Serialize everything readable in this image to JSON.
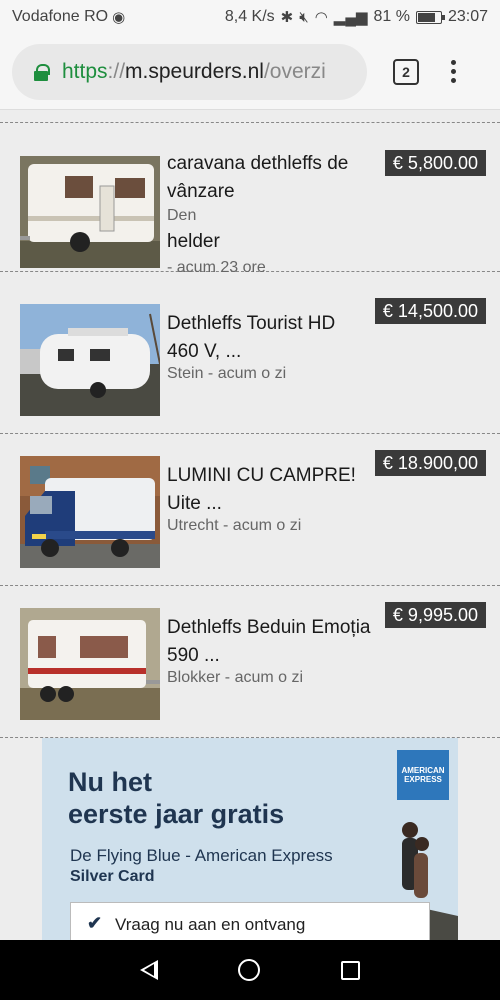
{
  "status_bar": {
    "carrier": "Vodafone RO",
    "speed": "8,4 K/s",
    "battery": "81 %",
    "battery_level": 0.81,
    "time": "23:07",
    "icons": [
      "whatsapp-icon",
      "bluetooth-icon",
      "mute-icon",
      "wifi-icon",
      "signal-icon",
      "battery-icon"
    ]
  },
  "browser": {
    "url_scheme": "https",
    "url_sep": "://",
    "url_host": "m.speurders.nl",
    "url_path": "/overzi",
    "tab_count": "2",
    "accent": "#1e8e3e"
  },
  "listings": [
    {
      "title": "caravana dethleffs de vânzare",
      "location_line1": "Den",
      "location_line2": "helder",
      "time": "- acum 23 ore",
      "price": "€ 5,800.00"
    },
    {
      "title": "Dethleffs Tourist HD 460 V, ...",
      "meta": "Stein - acum o zi",
      "price": "€ 14,500.00"
    },
    {
      "title": "LUMINI CU CAMPRE! Uite ...",
      "meta": "Utrecht - acum o zi",
      "price": "€ 18.900,00"
    },
    {
      "title": "Dethleffs Beduin Emoția 590 ...",
      "meta": "Blokker - acum o zi",
      "price": "€ 9,995.00"
    }
  ],
  "ad": {
    "headline_line1": "Nu het",
    "headline_line2": "eerste jaar gratis",
    "sub": "De Flying Blue - American Express",
    "sub2": "Silver Card",
    "logo_text": "AMERICAN EXPRESS",
    "cta": "Vraag nu aan en ontvang"
  }
}
